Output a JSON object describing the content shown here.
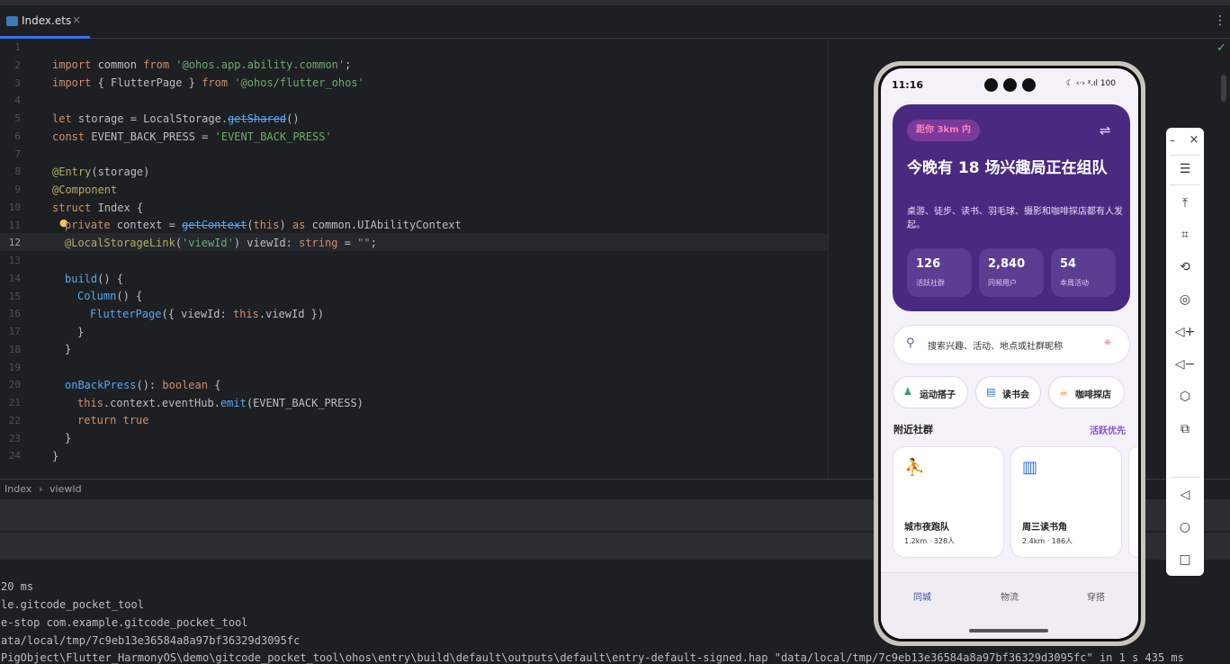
{
  "tab": {
    "file_name": "Index.ets",
    "close_glyph": "×"
  },
  "more_glyph": "⋮",
  "check_glyph": "✓",
  "line_numbers": [
    "1",
    "2",
    "3",
    "4",
    "5",
    "6",
    "7",
    "8",
    "9",
    "10",
    "11",
    "12",
    "13",
    "14",
    "15",
    "16",
    "17",
    "18",
    "19",
    "20",
    "21",
    "22",
    "23",
    "24"
  ],
  "code": {
    "l2": [
      "import",
      " common ",
      "from",
      " '@ohos.app.ability.common'",
      ";"
    ],
    "l3": [
      "import",
      " { FlutterPage } ",
      "from",
      " '@ohos/flutter_ohos'"
    ],
    "l5": [
      "let",
      " storage = LocalStorage.",
      "getShared",
      "()"
    ],
    "l6": [
      "const",
      " EVENT_BACK_PRESS = ",
      "'EVENT_BACK_PRESS'"
    ],
    "l8": [
      "@Entry",
      "(storage)"
    ],
    "l9": [
      "@Component"
    ],
    "l10": [
      "struct",
      " Index {"
    ],
    "l11": [
      "private",
      " context = ",
      "getContext",
      "(",
      "this",
      ") ",
      "as",
      " common.UIAbilityContext"
    ],
    "l12": [
      "@LocalStorageLink",
      "(",
      "'viewId'",
      ") viewId: ",
      "string",
      " = ",
      "\"\"",
      ";"
    ],
    "l14": [
      "build",
      "() {"
    ],
    "l15": [
      "Column",
      "() {"
    ],
    "l16": [
      "FlutterPage",
      "({ viewId: ",
      "this",
      ".viewId })"
    ],
    "l17": [
      "}"
    ],
    "l18": [
      "}"
    ],
    "l20": [
      "onBackPress",
      "(): ",
      "boolean",
      " {"
    ],
    "l21": [
      "this",
      ".context.eventHub.",
      "emit",
      "(EVENT_BACK_PRESS)"
    ],
    "l22": [
      "return",
      " ",
      "true"
    ],
    "l23": [
      "}"
    ],
    "l24": [
      "}"
    ]
  },
  "breadcrumb": {
    "item1": "Index",
    "sep": "›",
    "item2": "viewId"
  },
  "console": [
    "20 ms",
    "le.gitcode_pocket_tool",
    "e-stop com.example.gitcode_pocket_tool",
    "ata/local/tmp/7c9eb13e36584a8a97bf36329d3095fc",
    "PigObject\\Flutter_HarmonyOS\\demo\\gitcode_pocket_tool\\ohos\\entry\\build\\default\\outputs\\default\\entry-default-signed.hap \"data/local/tmp/7c9eb13e36584a8a97bf36329d3095fc\" in 1 s 435 ms"
  ],
  "phone": {
    "status": {
      "time": "11:16",
      "icons": "☾ ‹·› ᵡ.ıl 100"
    },
    "hero": {
      "badge": "距你 3km 内",
      "filter_icon": "⇌",
      "title": "今晚有 18 场兴趣局正在组队",
      "subtitle": "桌游、徒步、读书、羽毛球、摄影和咖啡探店都有人发起。",
      "stats": [
        {
          "value": "126",
          "label": "活跃社群"
        },
        {
          "value": "2,840",
          "label": "同频用户"
        },
        {
          "value": "54",
          "label": "本周活动"
        }
      ]
    },
    "search": {
      "placeholder": "搜索兴趣、活动、地点或社群昵称",
      "icon": "⚲",
      "pin": "⌖"
    },
    "chips": [
      {
        "icon": "♟",
        "label": "运动搭子",
        "color": "#2e9e55"
      },
      {
        "icon": "▤",
        "label": "读书会",
        "color": "#2f6fd8"
      },
      {
        "icon": "☕",
        "label": "咖啡探店",
        "color": "#e8832a"
      }
    ],
    "section": {
      "title": "附近社群",
      "link": "活跃优先"
    },
    "cards": [
      {
        "icon": "🏃",
        "name": "城市夜跑队",
        "meta": "1.2km · 328人",
        "color": "#2e9e55"
      },
      {
        "icon": "📖",
        "name": "周三读书角",
        "meta": "2.4km · 186人",
        "color": "#2f6fd8"
      }
    ],
    "nav": [
      "同城",
      "物流",
      "穿搭"
    ]
  },
  "tools": {
    "minimize": "–",
    "close": "×",
    "items": [
      "☰",
      "⤒",
      "⌗",
      "⟲",
      "◎",
      "◁+",
      "◁−",
      "⬡",
      "⧉"
    ],
    "nav": [
      "◁",
      "○",
      "□"
    ]
  }
}
